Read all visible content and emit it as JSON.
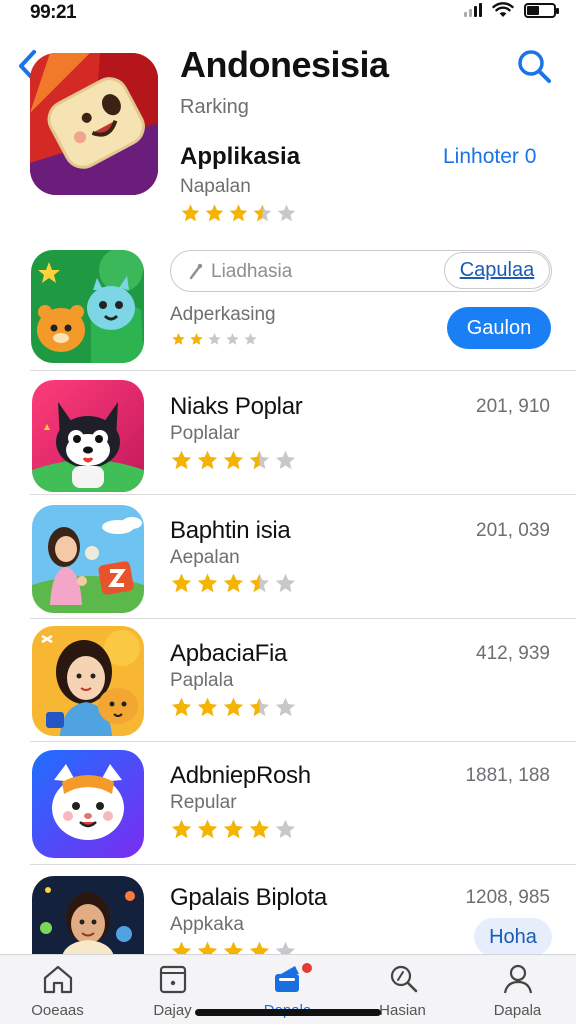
{
  "status": {
    "time": "99:21"
  },
  "header": {
    "title": "Andonesisia",
    "subtitle": "Rarking",
    "app_name": "Applikasia",
    "link": "Linhoter 0",
    "category": "Napalan",
    "rating": 3.5
  },
  "search": {
    "placeholder": "Liadhasia",
    "cancel_label": "Capulaa"
  },
  "promo": {
    "subtitle": "Adperkasing",
    "rating": 2,
    "get_label": "Gaulon"
  },
  "apps": [
    {
      "title": "Niaks Poplar",
      "subtitle": "Poplalar",
      "count": "201, 910",
      "rating": 3.5
    },
    {
      "title": "Baphtin isia",
      "subtitle": "Aepalan",
      "count": "201, 039",
      "rating": 3.5
    },
    {
      "title": "ApbaciaFia",
      "subtitle": "Paplala",
      "count": "412, 939",
      "rating": 3.5
    },
    {
      "title": "AdbniepRosh",
      "subtitle": "Repular",
      "count": "1881, 188",
      "rating": 4
    },
    {
      "title": "Gpalais Biplota",
      "subtitle": "Appkaka",
      "count": "1208, 985",
      "rating": 4,
      "action_label": "Hoha"
    }
  ],
  "tabs": [
    {
      "label": "Ooeaas",
      "icon": "home-icon"
    },
    {
      "label": "Dajay",
      "icon": "calendar-icon"
    },
    {
      "label": "Dopalo",
      "icon": "apps-stack-icon",
      "active": true
    },
    {
      "label": "Hasian",
      "icon": "search-icon"
    },
    {
      "label": "Dapala",
      "icon": "person-icon"
    }
  ],
  "colors": {
    "accent": "#1a7ef5",
    "link": "#1a73e8",
    "star": "#f4b400",
    "star_empty": "#c8c8cc"
  }
}
